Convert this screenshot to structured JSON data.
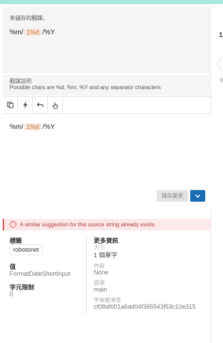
{
  "source": {
    "heading": "未儲存的翻譯。",
    "format_prefix": "%m/",
    "format_token": "1%d",
    "format_suffix": "/%Y"
  },
  "hint": {
    "title": "翻譯說明",
    "text": "Possible chars are %d, %m, %Y and any separator characters"
  },
  "toolbar": {
    "copy_icon": "copy-icon",
    "flash_icon": "lightning-icon",
    "undo_icon": "undo-icon",
    "hand_icon": "hand-icon"
  },
  "editor": {
    "prefix": "%m/",
    "token": "1%d",
    "suffix": "/%Y"
  },
  "actions": {
    "save_label": "儲存變更",
    "dropdown_icon": "chevron-down-icon"
  },
  "alert": {
    "text": "A similar suggestion for this source string already exists."
  },
  "info": {
    "tags_title": "標籤",
    "tag": "robotonet",
    "value_title": "值",
    "value": "FormatDateShortInput",
    "char_limit_title": "字元限制",
    "char_limit": "0",
    "more_title": "更多資訊",
    "size_label": "大小",
    "size_value": "1 個單字",
    "content_label": "內容",
    "content_value": "None",
    "resource_label": "資源",
    "resource_value": "main",
    "hash_label": "字串雜湊值",
    "hash_value": "cf08af001a6ad04f365543f53c10e315"
  },
  "right_panel": {
    "number": "1",
    "text": "卡"
  },
  "colors": {
    "accent": "#1b6db3",
    "topbar": "#a9e6dc",
    "alert_bg": "#fde9ea",
    "token_bg": "#f7e1d3"
  }
}
